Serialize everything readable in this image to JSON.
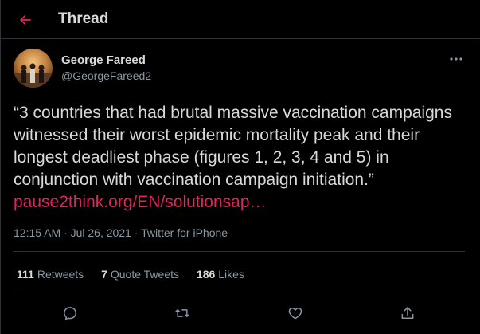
{
  "header": {
    "title": "Thread",
    "back_icon": "arrow-left-icon",
    "accent": "#e0245e"
  },
  "tweet": {
    "author_name": "George Fareed",
    "author_handle": "@GeorgeFareed2",
    "text": "“3 countries that had brutal massive vaccination campaigns witnessed their worst epidemic mortality peak and their longest deadliest phase (figures 1, 2, 3, 4 and 5) in conjunction with vaccination campaign initiation.” ",
    "link": "pause2think.org/EN/solutionsap…",
    "time": "12:15 AM",
    "dot": "·",
    "date": "Jul 26, 2021",
    "source": "Twitter for iPhone"
  },
  "stats": {
    "retweets_count": "111",
    "retweets_label": "Retweets",
    "quotes_count": "7",
    "quotes_label": "Quote Tweets",
    "likes_count": "186",
    "likes_label": "Likes"
  },
  "actions": {
    "reply_icon": "reply-icon",
    "retweet_icon": "retweet-icon",
    "like_icon": "heart-icon",
    "share_icon": "share-icon",
    "more_icon": "more-horizontal-icon"
  },
  "colors": {
    "background": "#000000",
    "text": "#d9d9d9",
    "muted": "#8899a6",
    "border": "#2f3336",
    "link": "#e0245e"
  }
}
